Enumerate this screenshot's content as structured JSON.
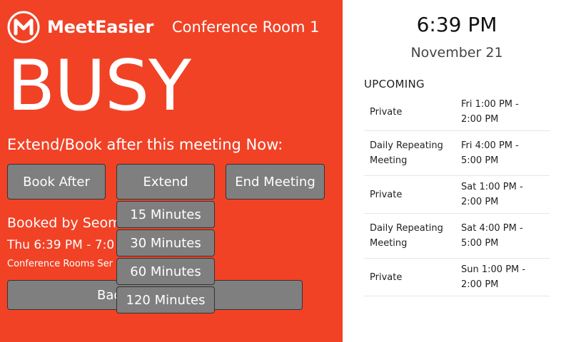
{
  "brand": {
    "name": "MeetEasier",
    "logo_letter": "M"
  },
  "room": {
    "name": "Conference Room 1"
  },
  "status": {
    "label": "BUSY"
  },
  "prompt": "Extend/Book after this meeting Now:",
  "actions": {
    "book_after": "Book After",
    "extend": "Extend",
    "end_meeting": "End Meeting",
    "back": "Back"
  },
  "extend_options": [
    "15 Minutes",
    "30 Minutes",
    "60 Minutes",
    "120 Minutes"
  ],
  "current_meeting": {
    "booked_by": "Booked by Seoma",
    "time_range": "Thu 6:39 PM - 7:0",
    "calendar": "Conference Rooms Ser"
  },
  "clock": {
    "time": "6:39 PM",
    "date": "November 21"
  },
  "upcoming": {
    "title": "UPCOMING",
    "items": [
      {
        "name": "Private",
        "when_start": "Fri 1:00 PM -",
        "when_end": "2:00 PM"
      },
      {
        "name_line1": "Daily Repeating",
        "name_line2": "Meeting",
        "when_start": "Fri 4:00 PM -",
        "when_end": "5:00 PM"
      },
      {
        "name": "Private",
        "when_start": "Sat 1:00 PM -",
        "when_end": "2:00 PM"
      },
      {
        "name_line1": "Daily Repeating",
        "name_line2": "Meeting",
        "when_start": "Sat 4:00 PM -",
        "when_end": "5:00 PM"
      },
      {
        "name": "Private",
        "when_start": "Sun 1:00 PM -",
        "when_end": "2:00 PM"
      }
    ]
  },
  "colors": {
    "busy_red": "#f14226",
    "button_gray": "#7f7f7f"
  }
}
